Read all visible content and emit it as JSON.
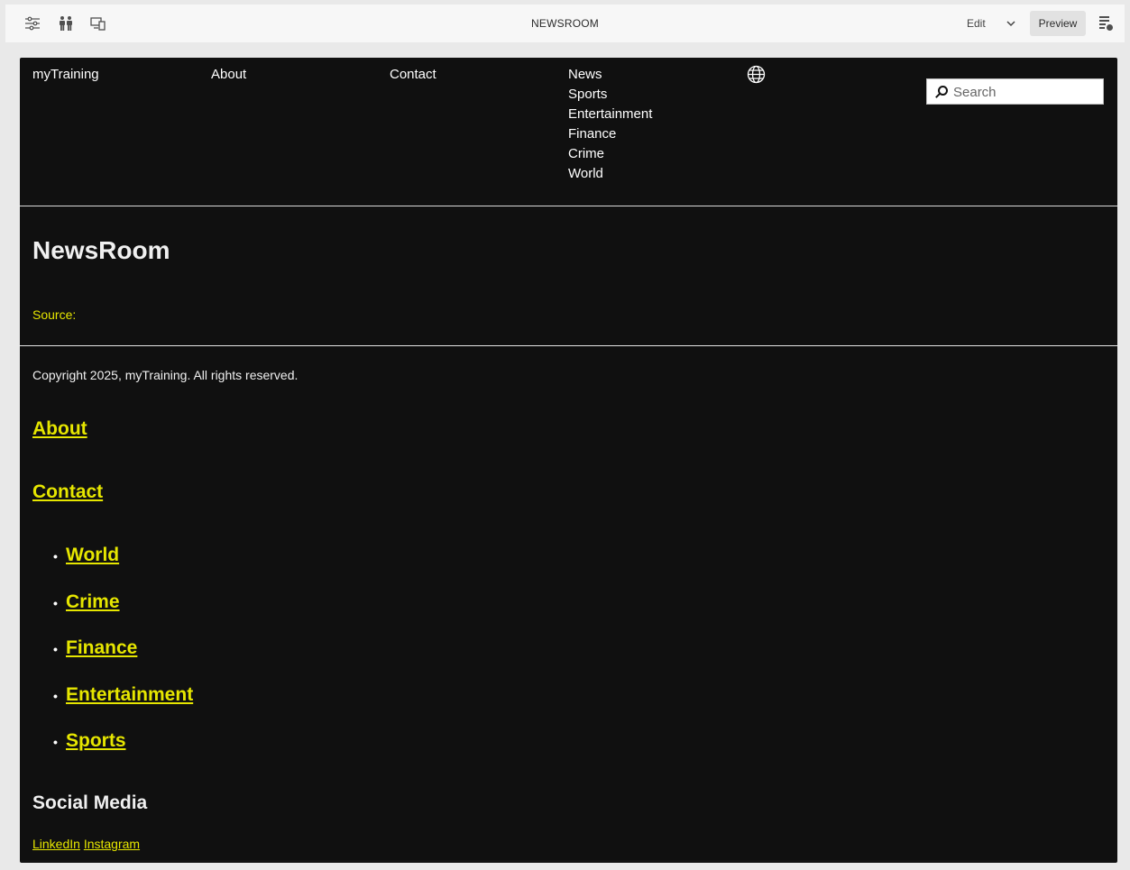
{
  "toolbar": {
    "title": "NEWSROOM",
    "edit_label": "Edit",
    "preview_label": "Preview",
    "icons": [
      "properties-icon",
      "people-icon",
      "device-icon",
      "chevron-down-icon",
      "emulator-icon"
    ]
  },
  "nav": {
    "brand": "myTraining",
    "about": "About",
    "contact": "Contact",
    "news_items": [
      "News",
      "Sports",
      "Entertainment",
      "Finance",
      "Crime",
      "World"
    ],
    "language_icon": "globe-icon",
    "search_placeholder": "Search"
  },
  "main": {
    "title": "NewsRoom",
    "source_label": "Source:"
  },
  "footer": {
    "copyright": "Copyright 2025, myTraining. All rights reserved.",
    "about": "About",
    "contact": "Contact",
    "sub_links": [
      "World",
      "Crime",
      "Finance",
      "Entertainment",
      "Sports"
    ],
    "social_heading": "Social Media",
    "social_links": [
      "LinkedIn",
      "Instagram"
    ]
  },
  "colors": {
    "page_bg": "#101010",
    "link": "#e6e600",
    "text": "#f0f0f0"
  }
}
